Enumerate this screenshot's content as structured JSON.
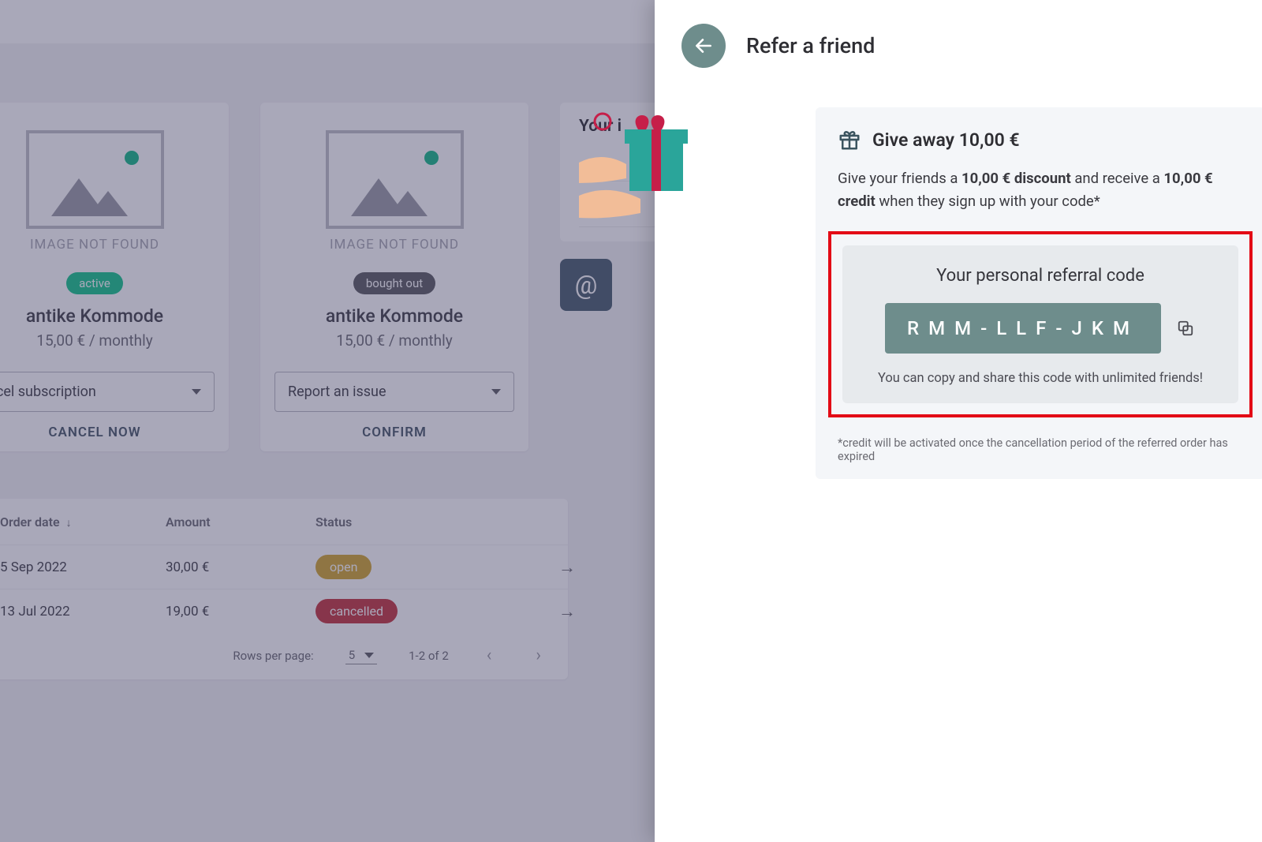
{
  "dashboard": {
    "img_not_found": "IMAGE NOT FOUND",
    "cards": [
      {
        "badge": "active",
        "badgeClass": "badge-active",
        "title": "antike Kommode",
        "price": "15,00 € / monthly",
        "select": "ncel subscription",
        "action": "CANCEL NOW"
      },
      {
        "badge": "bought out",
        "badgeClass": "badge-bought",
        "title": "antike Kommode",
        "price": "15,00 € / monthly",
        "select": "Report an issue",
        "action": "CONFIRM"
      }
    ],
    "side_title": "Your i",
    "orders": {
      "headers": {
        "date": "Order date",
        "amount": "Amount",
        "status": "Status"
      },
      "rows": [
        {
          "date": "5 Sep 2022",
          "amount": "30,00 €",
          "status": "open",
          "statusClass": "status-open"
        },
        {
          "date": "13 Jul 2022",
          "amount": "19,00 €",
          "status": "cancelled",
          "statusClass": "status-cancelled"
        }
      ],
      "rows_per_page_label": "Rows per page:",
      "rows_per_page_value": "5",
      "range": "1-2 of 2"
    }
  },
  "panel": {
    "title": "Refer a friend",
    "promo": {
      "heading": "Give away 10,00 €",
      "desc_pre": "Give your friends a ",
      "desc_bold1": "10,00 € discount",
      "desc_mid": " and receive a ",
      "desc_bold2": "10,00 € credit",
      "desc_post": " when they sign up with your code*",
      "code_title": "Your personal referral code",
      "code": "RMM-LLF-JKM",
      "code_hint": "You can copy and share this code with unlimited friends!",
      "footnote": "*credit will be activated once the cancellation period of the referred order has expired"
    }
  }
}
